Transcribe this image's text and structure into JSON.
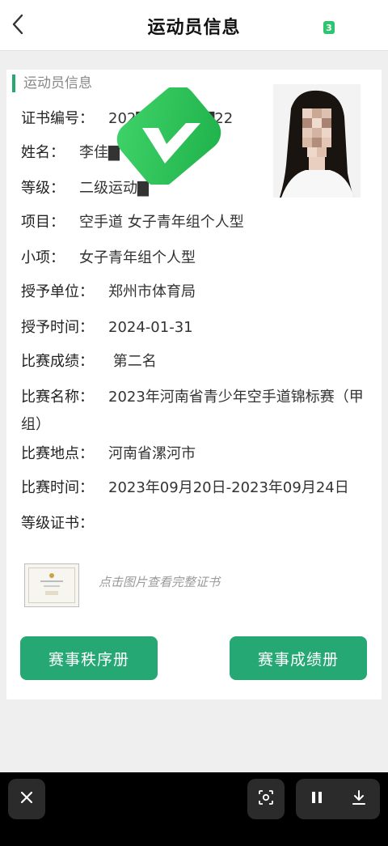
{
  "header": {
    "title": "运动员信息",
    "badge": "3"
  },
  "card": {
    "section_title": "运动员信息",
    "fields": [
      {
        "label": "证书编号：",
        "value": "202▇▇▇▇▇▇▇22"
      },
      {
        "label": "姓名：",
        "value": "李佳▇"
      },
      {
        "label": "等级：",
        "value": "二级运动▇"
      },
      {
        "label": "项目：",
        "value": "空手道 女子青年组个人型"
      },
      {
        "label": "小项：",
        "value": "女子青年组个人型"
      },
      {
        "label": "授予单位：",
        "value": "郑州市体育局"
      },
      {
        "label": "授予时间：",
        "value": "2024-01-31"
      },
      {
        "label": "比赛成绩：",
        "value": " 第二名"
      },
      {
        "label": "比赛名称：",
        "value": "2023年河南省青少年空手道锦标赛（甲组）"
      },
      {
        "label": "比赛地点：",
        "value": "河南省漯河市"
      },
      {
        "label": "比赛时间：",
        "value": "2023年09月20日-2023年09月24日"
      },
      {
        "label": "等级证书：",
        "value": ""
      }
    ],
    "certificate_hint": "点击图片查看完整证书",
    "buttons": {
      "order_book": "赛事秩序册",
      "results_book": "赛事成绩册"
    }
  },
  "colors": {
    "accent": "#25a874",
    "badge_green": "#33c45a"
  },
  "icons": [
    "back-icon",
    "verified-check-icon",
    "close-icon",
    "screenshot-icon",
    "pause-icon",
    "download-icon"
  ]
}
